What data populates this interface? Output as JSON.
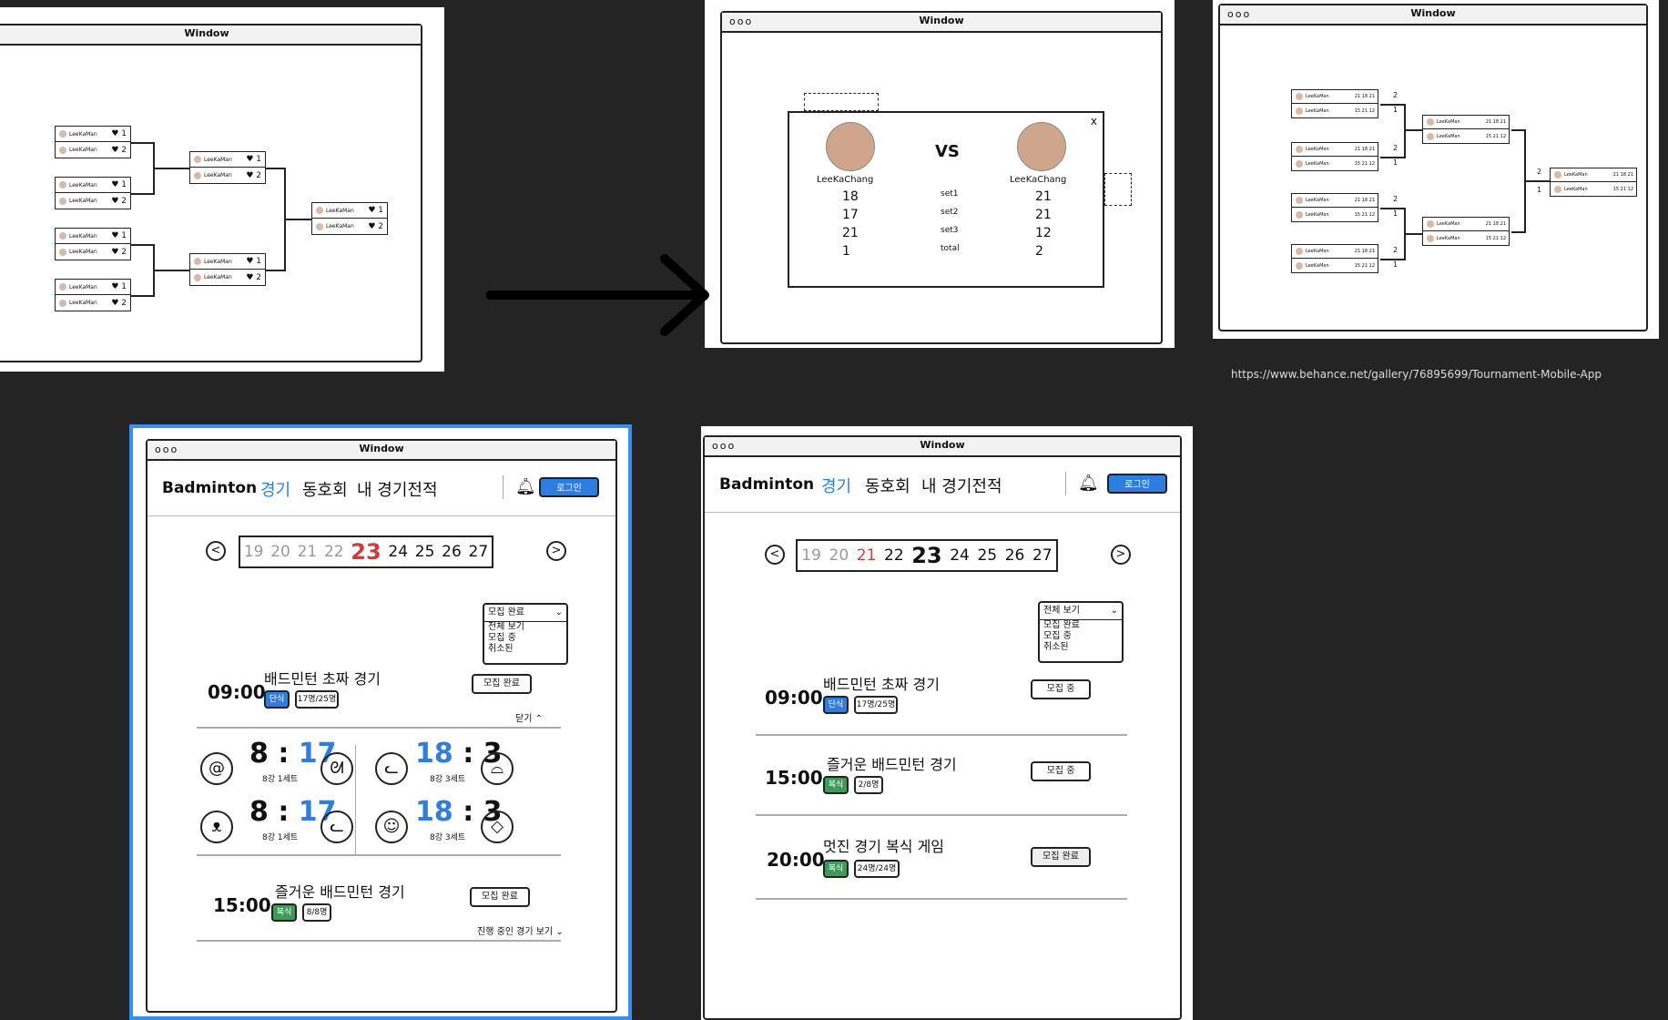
{
  "window_title": "Window",
  "bracket_players": {
    "name": "LeeKaMan",
    "left": [
      "1",
      "2",
      "1",
      "2",
      "1",
      "2",
      "1",
      "2"
    ],
    "mid": [
      "1",
      "2",
      "1",
      "2"
    ],
    "final": [
      "1",
      "2"
    ]
  },
  "match_modal": {
    "left_player": "LeeKaChang",
    "right_player": "LeeKaChang",
    "vs": "VS",
    "close": "x",
    "sets": [
      {
        "left": "18",
        "label": "set1",
        "right": "21"
      },
      {
        "left": "17",
        "label": "set2",
        "right": "21"
      },
      {
        "left": "21",
        "label": "set3",
        "right": "12"
      },
      {
        "left": "1",
        "label": "total",
        "right": "2"
      }
    ]
  },
  "link_url": "https://www.behance.net/gallery/76895699/Tournament-Mobile-App",
  "app": {
    "brand": "Badminton",
    "tabs": [
      "경기",
      "동호회",
      "내 경기전적"
    ],
    "login": "로그인",
    "dates": [
      "19",
      "20",
      "21",
      "22",
      "23",
      "24",
      "25",
      "26",
      "27"
    ],
    "prev": "<",
    "next": ">"
  },
  "left_screen": {
    "dropdown": {
      "selected": "모집 완료",
      "options": [
        "전체 보기",
        "모집 중",
        "취소된"
      ]
    },
    "matches": [
      {
        "time": "09:00",
        "title": "배드민턴 초짜 경기",
        "type": "단식",
        "count": "17명/25명",
        "status": "모집 완료"
      },
      {
        "time": "15:00",
        "title": "즐거운 배드민턴 경기",
        "type": "복식",
        "count": "8/8명",
        "status": "모집 완료"
      }
    ],
    "close_label": "닫기",
    "more_label": "진행 중인 경기 보기",
    "scores": [
      {
        "left": "8",
        "right": "17",
        "sub": "8강 1세트"
      },
      {
        "left": "18",
        "right": "3",
        "sub": "8강 3세트"
      },
      {
        "left": "8",
        "right": "17",
        "sub": "8강 1세트"
      },
      {
        "left": "18",
        "right": "3",
        "sub": "8강 3세트"
      }
    ]
  },
  "right_screen": {
    "dropdown": {
      "selected": "전체 보기",
      "options": [
        "모집 완료",
        "모집 중",
        "취소된"
      ]
    },
    "matches": [
      {
        "time": "09:00",
        "title": "배드민턴 초짜 경기",
        "type": "단식",
        "count": "17명/25명",
        "status": "모집 중"
      },
      {
        "time": "15:00",
        "title": "즐거운 배드민턴 경기",
        "type": "복식",
        "count": "2/8명",
        "status": "모집 중"
      },
      {
        "time": "20:00",
        "title": "멋진 경기 복식 게임",
        "type": "복식",
        "count": "24명/24명",
        "status": "모집 완료"
      }
    ]
  },
  "colors": {
    "accent_blue": "#2f7de1",
    "accent_red": "#d43a3a",
    "tag_green": "#3f9a5a",
    "background": "#242424"
  }
}
